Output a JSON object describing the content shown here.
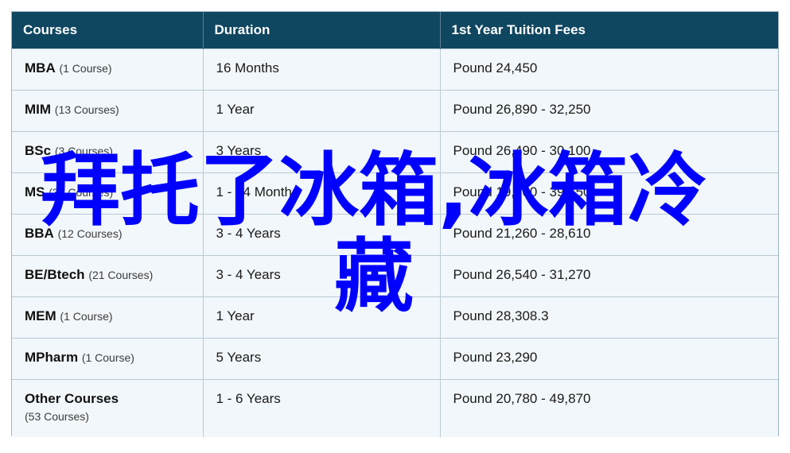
{
  "headers": {
    "courses": "Courses",
    "duration": "Duration",
    "fees": "1st Year Tuition Fees"
  },
  "rows": [
    {
      "name": "MBA",
      "count": "(1 Course)",
      "duration": "16 Months",
      "fees": "Pound 24,450"
    },
    {
      "name": "MIM",
      "count": "(13 Courses)",
      "duration": "1 Year",
      "fees": "Pound 26,890 - 32,250"
    },
    {
      "name": "BSc",
      "count": "(3 Courses)",
      "duration": "3 Years",
      "fees": "Pound 26,490 - 30,100"
    },
    {
      "name": "MS",
      "count": "(30 Courses)",
      "duration": "1 - 24 Months",
      "fees": "Pound 19,300 - 39,150"
    },
    {
      "name": "BBA",
      "count": "(12 Courses)",
      "duration": "3 - 4 Years",
      "fees": "Pound 21,260 - 28,610"
    },
    {
      "name": "BE/Btech",
      "count": "(21 Courses)",
      "duration": "3 - 4 Years",
      "fees": "Pound 26,540 - 31,270"
    },
    {
      "name": "MEM",
      "count": "(1 Course)",
      "duration": "1 Year",
      "fees": "Pound 28,308.3"
    },
    {
      "name": "MPharm",
      "count": "(1 Course)",
      "duration": "5 Years",
      "fees": "Pound 23,290"
    },
    {
      "name": "Other Courses",
      "count": "(53 Courses)",
      "duration": "1 - 6 Years",
      "fees": "Pound 20,780 - 49,870"
    }
  ],
  "watermark": {
    "line1": "拜托了冰箱,冰箱冷",
    "line2": "藏",
    "color": "#0000ff"
  },
  "colors": {
    "header_bg": "#0f4660",
    "row_bg": "#f2f7fb"
  }
}
